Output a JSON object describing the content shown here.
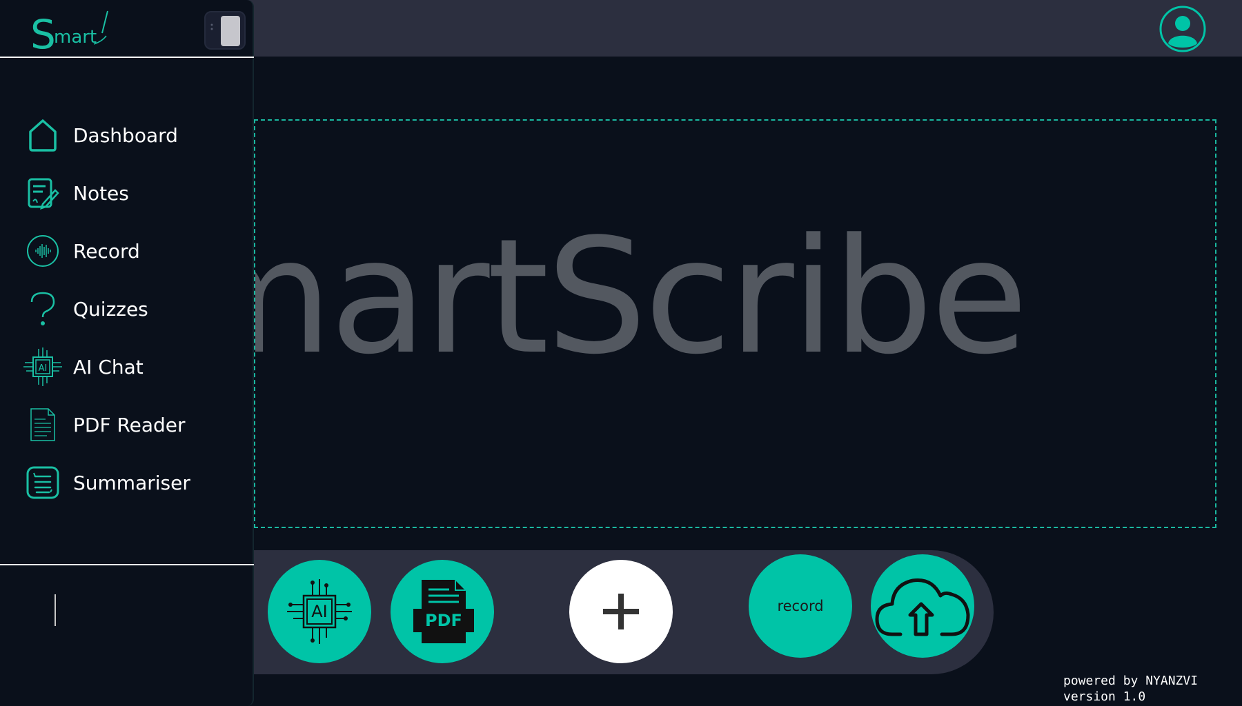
{
  "app": {
    "logo_text": "Smart",
    "hero_text": "martScribe"
  },
  "colors": {
    "accent": "#00c4a7",
    "background": "#0a101b",
    "topbar": "#2c2f3f",
    "hero_text": "#535860"
  },
  "sidebar": {
    "toggle_icon": "sidebar-toggle-icon",
    "items": [
      {
        "label": "Dashboard",
        "icon": "home-icon"
      },
      {
        "label": "Notes",
        "icon": "notes-icon"
      },
      {
        "label": "Record",
        "icon": "waveform-icon"
      },
      {
        "label": "Quizzes",
        "icon": "question-icon"
      },
      {
        "label": "AI Chat",
        "icon": "ai-chip-icon"
      },
      {
        "label": "PDF Reader",
        "icon": "document-icon"
      },
      {
        "label": "Summariser",
        "icon": "summary-icon"
      }
    ]
  },
  "header": {
    "avatar_icon": "user-icon"
  },
  "dock": {
    "ai_icon": "ai-chip-icon",
    "pdf_label": "PDF",
    "add_icon": "plus-icon",
    "record_label": "record",
    "upload_icon": "cloud-upload-icon"
  },
  "footer": {
    "powered_by": "powered by NYANZVI",
    "version": "version 1.0"
  }
}
